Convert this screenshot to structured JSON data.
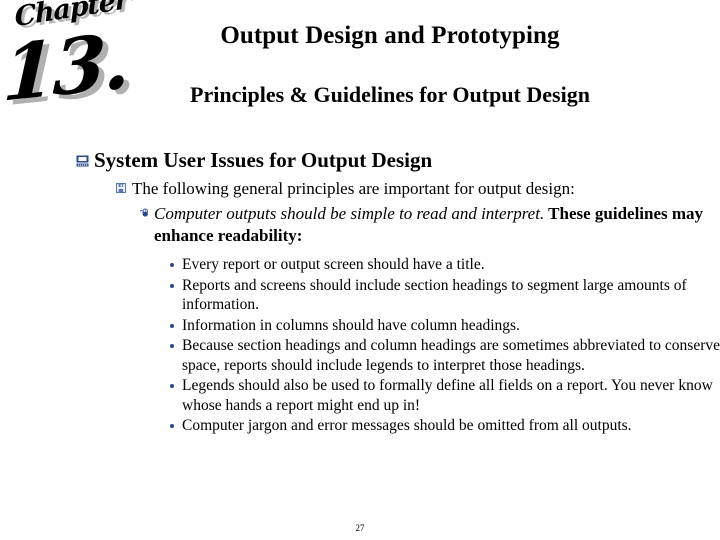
{
  "logo": {
    "word": "Chapter",
    "number": "13."
  },
  "title": "Output Design and Prototyping",
  "subtitle": "Principles & Guidelines for Output Design",
  "colors": {
    "bullet_blue": "#2a4b8d",
    "logo_shadow": "#b0b0b0",
    "text": "#000000",
    "background": "#ffffff"
  },
  "outline": {
    "level1": {
      "icon": "computer-monitor-icon",
      "text": "System User Issues for Output Design"
    },
    "level2": {
      "icon": "floppy-disk-icon",
      "text": "The following general principles are important for output design:"
    },
    "level3": {
      "icon": "mouse-icon",
      "emphasis": "Computer outputs should be simple to read and interpret.",
      "text": " These guidelines may enhance readability:"
    },
    "level4": {
      "icon": "dot-bullet-icon",
      "items": [
        "Every report or output screen should have a title.",
        "Reports and screens should include section headings to segment large amounts of information.",
        "Information in columns should have column headings.",
        "Because section headings and column headings are sometimes abbreviated to conserve space, reports should include legends to interpret those headings.",
        "Legends should also be used to formally define all fields on a report. You never know whose hands a report might end up in!",
        "Computer jargon and error messages should be omitted from all outputs."
      ]
    }
  },
  "page_number": "27"
}
